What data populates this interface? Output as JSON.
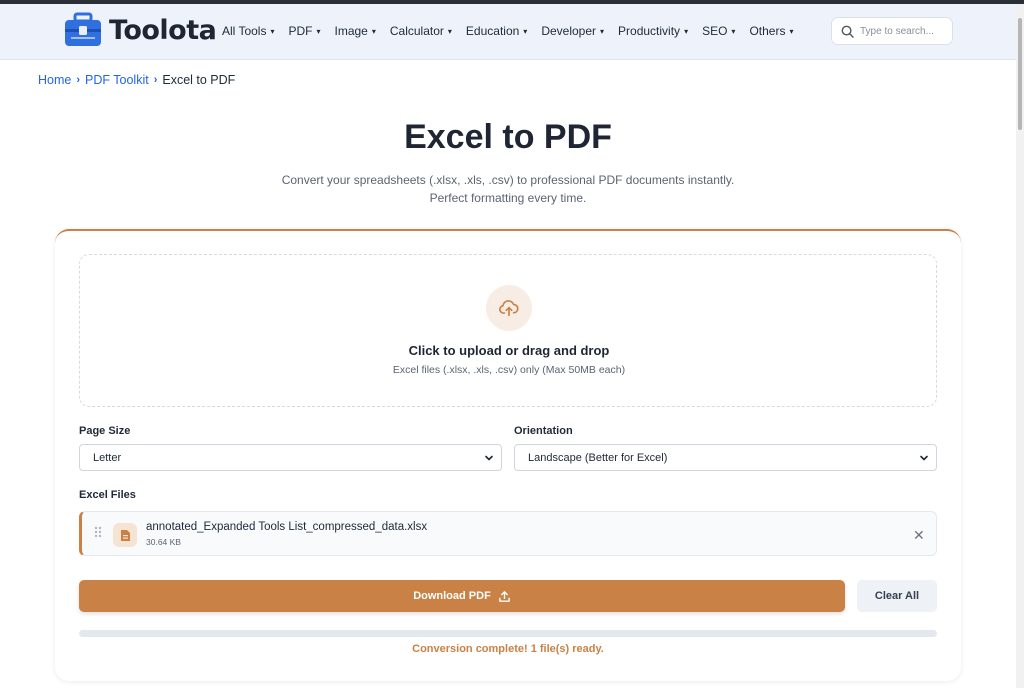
{
  "header": {
    "logo_text": "Toolota",
    "nav": [
      {
        "label": "All Tools"
      },
      {
        "label": "PDF"
      },
      {
        "label": "Image"
      },
      {
        "label": "Calculator"
      },
      {
        "label": "Education"
      },
      {
        "label": "Developer"
      },
      {
        "label": "Productivity"
      },
      {
        "label": "SEO"
      },
      {
        "label": "Others"
      }
    ],
    "search_placeholder": "Type to search..."
  },
  "breadcrumb": {
    "home": "Home",
    "section": "PDF Toolkit",
    "current": "Excel to PDF"
  },
  "page": {
    "title": "Excel to PDF",
    "subtitle_line1": "Convert your spreadsheets (.xlsx, .xls, .csv) to professional PDF documents instantly.",
    "subtitle_line2": "Perfect formatting every time."
  },
  "upload": {
    "icon": "upload-cloud-icon",
    "title": "Click to upload or drag and drop",
    "hint": "Excel files (.xlsx, .xls, .csv) only (Max 50MB each)"
  },
  "options": {
    "page_size_label": "Page Size",
    "page_size_value": "Letter",
    "orientation_label": "Orientation",
    "orientation_value": "Landscape (Better for Excel)"
  },
  "files": {
    "label": "Excel Files",
    "items": [
      {
        "name": "annotated_Expanded Tools List_compressed_data.xlsx",
        "size": "30.64 KB"
      }
    ]
  },
  "actions": {
    "download_label": "Download PDF",
    "clear_label": "Clear All"
  },
  "status": {
    "message": "Conversion complete! 1 file(s) ready."
  },
  "colors": {
    "accent": "#c98146",
    "link": "#2563eb",
    "header_bg": "#eef3fb"
  }
}
